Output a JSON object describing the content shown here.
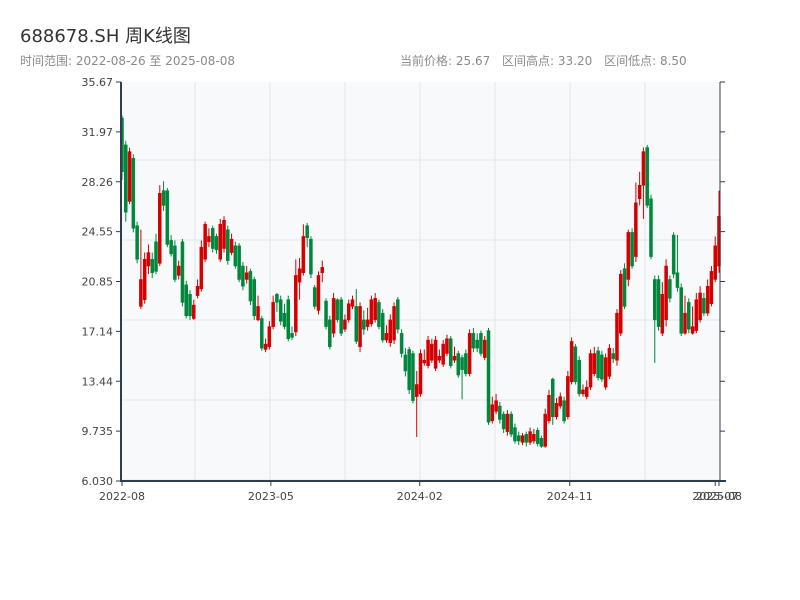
{
  "header": {
    "title": "688678.SH 周K线图",
    "range_label": "时间范围: 2022-08-26 至 2025-08-08",
    "current_price": "当前价格: 25.67",
    "range_high": "区间高点: 33.20",
    "range_low": "区间低点: 8.50"
  },
  "colors": {
    "up": "#d40000",
    "down": "#00873c",
    "axis": "#2c3e50",
    "grid": "#e3e6ea",
    "plot_bg": "#f7f9fb"
  },
  "chart_data": {
    "type": "candlestick",
    "title": "688678.SH 周K线图",
    "ylim": [
      6.03,
      35.67
    ],
    "yticks": [
      "6.030",
      "9.735",
      "13.44",
      "17.14",
      "20.85",
      "24.55",
      "28.26",
      "31.97",
      "35.67"
    ],
    "xticks": [
      {
        "label": "2022-08",
        "index": 0
      },
      {
        "label": "2023-05",
        "index": 39.4
      },
      {
        "label": "2024-02",
        "index": 78.8
      },
      {
        "label": "2024-11",
        "index": 118.5
      },
      {
        "label": "2025-07",
        "index": 157
      },
      {
        "label": "2025-08",
        "index": 158
      }
    ],
    "candle_fields": [
      "open",
      "close",
      "high",
      "low"
    ],
    "candles": [
      [
        33.0,
        29.0,
        33.2,
        28.4
      ],
      [
        31.0,
        26.0,
        31.3,
        25.3
      ],
      [
        26.8,
        30.5,
        30.8,
        26.6
      ],
      [
        30.0,
        24.8,
        30.3,
        24.5
      ],
      [
        25.0,
        22.5,
        25.3,
        22.2
      ],
      [
        19.0,
        21.0,
        24.7,
        18.8
      ],
      [
        19.5,
        22.5,
        23.0,
        19.2
      ],
      [
        22.0,
        23.0,
        23.6,
        21.4
      ],
      [
        22.5,
        21.5,
        23.0,
        21.1
      ],
      [
        23.8,
        21.6,
        24.4,
        21.4
      ],
      [
        22.2,
        27.4,
        28.0,
        22.0
      ],
      [
        27.6,
        26.5,
        28.3,
        26.1
      ],
      [
        27.6,
        23.6,
        27.8,
        23.4
      ],
      [
        23.9,
        22.9,
        24.3,
        22.7
      ],
      [
        23.5,
        21.0,
        23.9,
        20.8
      ],
      [
        21.3,
        22.0,
        22.4,
        21.0
      ],
      [
        23.8,
        19.3,
        24.0,
        19.0
      ],
      [
        20.6,
        18.3,
        20.9,
        18.1
      ],
      [
        19.9,
        18.3,
        20.2,
        18.0
      ],
      [
        18.1,
        19.1,
        19.5,
        18.0
      ],
      [
        19.8,
        20.5,
        21.0,
        19.6
      ],
      [
        20.3,
        23.4,
        23.9,
        20.1
      ],
      [
        22.5,
        25.1,
        25.3,
        22.3
      ],
      [
        23.8,
        24.2,
        24.8,
        23.4
      ],
      [
        24.8,
        23.3,
        25.0,
        23.0
      ],
      [
        24.2,
        23.2,
        24.4,
        22.9
      ],
      [
        22.5,
        25.1,
        25.5,
        22.3
      ],
      [
        23.3,
        25.4,
        25.7,
        23.0
      ],
      [
        24.7,
        22.4,
        25.0,
        22.1
      ],
      [
        23.0,
        24.0,
        24.4,
        22.8
      ],
      [
        23.5,
        22.0,
        23.8,
        21.8
      ],
      [
        23.5,
        21.0,
        23.7,
        20.8
      ],
      [
        22.0,
        20.5,
        22.3,
        20.2
      ],
      [
        21.0,
        21.5,
        22.0,
        20.7
      ],
      [
        21.6,
        19.4,
        21.8,
        19.1
      ],
      [
        21.0,
        18.3,
        21.2,
        18.0
      ],
      [
        18.0,
        19.0,
        19.8,
        17.9
      ],
      [
        18.1,
        15.9,
        18.3,
        15.7
      ],
      [
        15.8,
        16.2,
        16.6,
        15.6
      ],
      [
        16.0,
        17.5,
        17.9,
        15.8
      ],
      [
        17.5,
        19.3,
        19.8,
        17.3
      ],
      [
        19.9,
        19.3,
        20.0,
        18.6
      ],
      [
        19.5,
        17.9,
        19.8,
        17.6
      ],
      [
        18.5,
        17.5,
        19.2,
        17.3
      ],
      [
        19.5,
        16.6,
        19.8,
        16.4
      ],
      [
        17.0,
        16.7,
        17.5,
        16.5
      ],
      [
        17.1,
        21.3,
        22.5,
        16.8
      ],
      [
        20.8,
        21.8,
        22.6,
        19.5
      ],
      [
        21.5,
        24.2,
        25.1,
        21.3
      ],
      [
        25.0,
        24.1,
        25.2,
        23.4
      ],
      [
        24.0,
        21.4,
        24.2,
        21.1
      ],
      [
        20.4,
        19.0,
        20.6,
        18.8
      ],
      [
        18.7,
        21.3,
        21.6,
        18.4
      ],
      [
        21.5,
        21.9,
        22.4,
        20.8
      ],
      [
        19.4,
        17.5,
        19.6,
        17.3
      ],
      [
        18.0,
        16.0,
        18.3,
        15.8
      ],
      [
        17.0,
        19.6,
        20.0,
        16.7
      ],
      [
        19.5,
        18.0,
        19.6,
        17.8
      ],
      [
        19.5,
        17.0,
        19.7,
        16.8
      ],
      [
        17.3,
        18.0,
        18.4,
        17.1
      ],
      [
        18.0,
        19.2,
        19.5,
        17.8
      ],
      [
        19.0,
        19.5,
        19.8,
        18.8
      ],
      [
        19.0,
        16.4,
        20.3,
        16.2
      ],
      [
        16.0,
        19.0,
        19.3,
        15.6
      ],
      [
        18.0,
        17.3,
        18.7,
        16.9
      ],
      [
        17.5,
        18.0,
        18.9,
        17.2
      ],
      [
        17.7,
        19.5,
        19.8,
        17.5
      ],
      [
        18.0,
        19.6,
        20.0,
        17.8
      ],
      [
        19.3,
        17.5,
        19.5,
        17.3
      ],
      [
        18.5,
        16.5,
        18.8,
        16.3
      ],
      [
        16.5,
        17.0,
        17.6,
        16.3
      ],
      [
        16.3,
        18.0,
        18.4,
        16.0
      ],
      [
        16.5,
        19.0,
        19.3,
        16.2
      ],
      [
        19.5,
        17.3,
        19.7,
        17.0
      ],
      [
        17.0,
        15.5,
        17.3,
        15.2
      ],
      [
        15.4,
        14.2,
        15.9,
        13.8
      ],
      [
        15.8,
        12.8,
        16.0,
        12.5
      ],
      [
        15.5,
        12.0,
        15.7,
        11.8
      ],
      [
        12.3,
        13.2,
        14.2,
        9.3
      ],
      [
        12.5,
        15.5,
        15.8,
        12.3
      ],
      [
        14.8,
        15.0,
        15.8,
        14.6
      ],
      [
        14.6,
        16.5,
        16.8,
        14.4
      ],
      [
        15.0,
        16.2,
        16.6,
        14.8
      ],
      [
        14.4,
        16.5,
        16.8,
        14.2
      ],
      [
        15.0,
        15.3,
        15.8,
        14.8
      ],
      [
        14.7,
        16.2,
        16.5,
        14.5
      ],
      [
        15.5,
        16.6,
        16.9,
        15.3
      ],
      [
        16.6,
        14.6,
        16.8,
        14.4
      ],
      [
        15.0,
        15.3,
        16.0,
        14.8
      ],
      [
        15.5,
        13.9,
        15.7,
        13.7
      ],
      [
        15.2,
        14.3,
        15.4,
        12.1
      ],
      [
        15.5,
        14.0,
        15.8,
        13.8
      ],
      [
        14.0,
        17.0,
        17.3,
        13.8
      ],
      [
        17.0,
        15.9,
        17.4,
        15.6
      ],
      [
        16.5,
        15.9,
        17.0,
        15.6
      ],
      [
        17.0,
        15.5,
        17.2,
        15.3
      ],
      [
        15.2,
        16.5,
        16.8,
        15.0
      ],
      [
        17.2,
        10.4,
        17.4,
        10.2
      ],
      [
        10.5,
        11.7,
        12.3,
        10.3
      ],
      [
        11.2,
        12.0,
        12.5,
        11.0
      ],
      [
        11.6,
        10.6,
        11.9,
        10.3
      ],
      [
        11.0,
        9.9,
        11.2,
        9.6
      ],
      [
        9.7,
        11.0,
        11.3,
        9.4
      ],
      [
        11.0,
        9.5,
        11.2,
        9.3
      ],
      [
        10.0,
        9.0,
        10.3,
        8.8
      ],
      [
        9.4,
        9.0,
        9.7,
        8.7
      ],
      [
        8.9,
        9.4,
        9.6,
        8.7
      ],
      [
        9.5,
        8.9,
        9.7,
        8.6
      ],
      [
        8.9,
        9.7,
        10.0,
        8.7
      ],
      [
        9.0,
        9.5,
        9.9,
        8.8
      ],
      [
        9.8,
        8.8,
        10.0,
        8.6
      ],
      [
        9.2,
        8.6,
        9.4,
        8.5
      ],
      [
        8.6,
        11.0,
        11.4,
        8.5
      ],
      [
        10.5,
        12.4,
        12.8,
        10.3
      ],
      [
        13.6,
        10.8,
        13.7,
        10.2
      ],
      [
        10.8,
        11.8,
        12.2,
        10.6
      ],
      [
        11.6,
        12.3,
        12.6,
        11.4
      ],
      [
        12.0,
        10.5,
        12.3,
        10.3
      ],
      [
        10.8,
        13.8,
        14.2,
        10.6
      ],
      [
        13.4,
        16.4,
        16.7,
        13.2
      ],
      [
        16.0,
        13.4,
        16.2,
        13.2
      ],
      [
        15.0,
        12.5,
        15.3,
        12.3
      ],
      [
        12.5,
        12.8,
        13.2,
        12.3
      ],
      [
        12.3,
        13.0,
        13.5,
        12.1
      ],
      [
        13.0,
        15.5,
        15.8,
        12.8
      ],
      [
        14.0,
        15.5,
        16.0,
        13.8
      ],
      [
        15.7,
        13.7,
        16.0,
        13.5
      ],
      [
        15.4,
        13.6,
        15.7,
        13.4
      ],
      [
        13.0,
        15.2,
        15.5,
        12.8
      ],
      [
        13.8,
        15.9,
        16.2,
        13.6
      ],
      [
        15.5,
        15.1,
        15.9,
        14.8
      ],
      [
        15.0,
        18.5,
        18.8,
        14.6
      ],
      [
        17.0,
        21.4,
        21.7,
        16.8
      ],
      [
        21.8,
        19.0,
        22.2,
        18.8
      ],
      [
        21.0,
        24.5,
        24.7,
        20.5
      ],
      [
        24.5,
        22.0,
        24.8,
        21.8
      ],
      [
        22.7,
        26.7,
        28.2,
        22.3
      ],
      [
        27.0,
        28.0,
        29.0,
        26.5
      ],
      [
        28.0,
        30.5,
        30.8,
        25.5
      ],
      [
        30.8,
        26.5,
        31.0,
        26.3
      ],
      [
        27.0,
        22.7,
        27.3,
        22.5
      ],
      [
        21.0,
        18.0,
        21.3,
        14.8
      ],
      [
        21.0,
        17.5,
        21.3,
        17.2
      ],
      [
        17.0,
        19.9,
        20.8,
        16.8
      ],
      [
        18.0,
        22.0,
        22.5,
        17.5
      ],
      [
        21.0,
        19.6,
        21.3,
        19.3
      ],
      [
        24.3,
        21.4,
        24.5,
        21.1
      ],
      [
        21.5,
        20.4,
        24.3,
        20.1
      ],
      [
        20.4,
        17.0,
        20.7,
        16.8
      ],
      [
        17.0,
        18.5,
        19.8,
        16.9
      ],
      [
        19.3,
        17.3,
        19.6,
        17.0
      ],
      [
        17.0,
        17.5,
        19.0,
        16.9
      ],
      [
        17.2,
        19.5,
        20.0,
        17.0
      ],
      [
        18.0,
        20.0,
        20.5,
        17.8
      ],
      [
        19.6,
        18.5,
        20.0,
        18.3
      ],
      [
        18.5,
        20.5,
        21.0,
        18.3
      ],
      [
        19.2,
        21.6,
        22.0,
        19.0
      ],
      [
        21.0,
        23.5,
        24.2,
        20.8
      ],
      [
        22.0,
        25.7,
        27.6,
        21.5
      ]
    ]
  }
}
